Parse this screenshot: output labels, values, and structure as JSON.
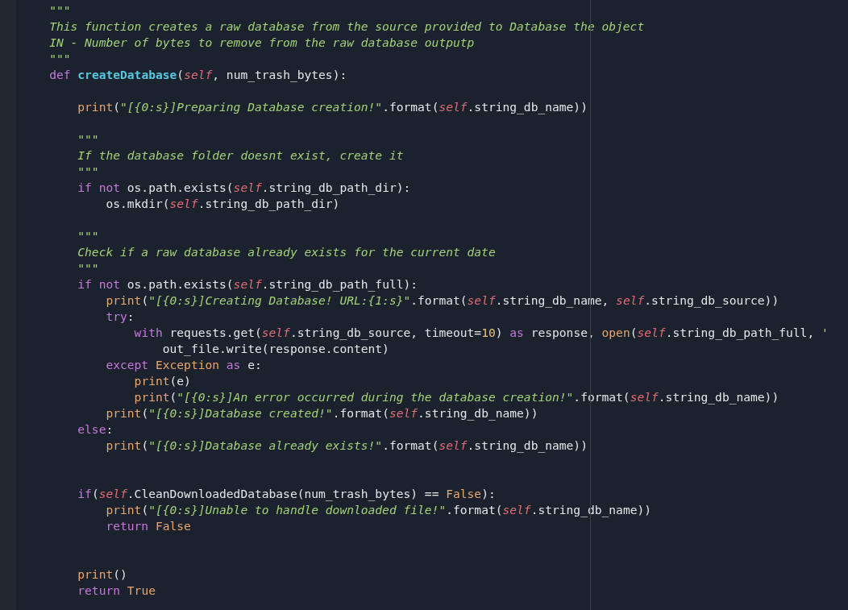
{
  "editor": {
    "sections": [
      {
        "paragraphs": [
          {
            "lines": [
              {
                "tokens": [
                  {
                    "kind": "string",
                    "text": "    \"\"\""
                  }
                ]
              },
              {
                "tokens": [
                  {
                    "kind": "string",
                    "text": "    This function creates a raw database from the source provided to Database the object"
                  }
                ]
              },
              {
                "tokens": [
                  {
                    "kind": "string",
                    "text": "    IN - Number of bytes to remove from the raw database outputp"
                  }
                ]
              },
              {
                "tokens": [
                  {
                    "kind": "string",
                    "text": "    \"\"\""
                  }
                ]
              },
              {
                "tokens": [
                  {
                    "kind": "keyword",
                    "text": "    def "
                  },
                  {
                    "kind": "function",
                    "text": "createDatabase"
                  },
                  {
                    "kind": "plain",
                    "text": "("
                  },
                  {
                    "kind": "self",
                    "text": "self"
                  },
                  {
                    "kind": "plain",
                    "text": ", num_trash_bytes):"
                  }
                ]
              }
            ]
          },
          {
            "lines": [
              {
                "tokens": [
                  {
                    "kind": "builtin",
                    "text": "        print"
                  },
                  {
                    "kind": "plain",
                    "text": "("
                  },
                  {
                    "kind": "string",
                    "text": "\"[{0:s}]Preparing Database creation!\""
                  },
                  {
                    "kind": "plain",
                    "text": ".format("
                  },
                  {
                    "kind": "self",
                    "text": "self"
                  },
                  {
                    "kind": "plain",
                    "text": ".string_db_name))"
                  }
                ]
              }
            ]
          },
          {
            "lines": [
              {
                "tokens": [
                  {
                    "kind": "string",
                    "text": "        \"\"\""
                  }
                ]
              },
              {
                "tokens": [
                  {
                    "kind": "string",
                    "text": "        If the database folder doesnt exist, create it"
                  }
                ]
              },
              {
                "tokens": [
                  {
                    "kind": "string",
                    "text": "        \"\"\""
                  }
                ]
              },
              {
                "tokens": [
                  {
                    "kind": "keyword",
                    "text": "        if "
                  },
                  {
                    "kind": "keyword",
                    "text": "not"
                  },
                  {
                    "kind": "plain",
                    "text": " os.path.exists("
                  },
                  {
                    "kind": "self",
                    "text": "self"
                  },
                  {
                    "kind": "plain",
                    "text": ".string_db_path_dir):"
                  }
                ]
              },
              {
                "tokens": [
                  {
                    "kind": "plain",
                    "text": "            os.mkdir("
                  },
                  {
                    "kind": "self",
                    "text": "self"
                  },
                  {
                    "kind": "plain",
                    "text": ".string_db_path_dir)"
                  }
                ]
              }
            ]
          },
          {
            "lines": [
              {
                "tokens": [
                  {
                    "kind": "string",
                    "text": "        \"\"\""
                  }
                ]
              },
              {
                "tokens": [
                  {
                    "kind": "string",
                    "text": "        Check if a raw database already exists for the current date"
                  }
                ]
              },
              {
                "tokens": [
                  {
                    "kind": "string",
                    "text": "        \"\"\""
                  }
                ]
              },
              {
                "tokens": [
                  {
                    "kind": "keyword",
                    "text": "        if "
                  },
                  {
                    "kind": "keyword",
                    "text": "not"
                  },
                  {
                    "kind": "plain",
                    "text": " os.path.exists("
                  },
                  {
                    "kind": "self",
                    "text": "self"
                  },
                  {
                    "kind": "plain",
                    "text": ".string_db_path_full):"
                  }
                ]
              },
              {
                "tokens": [
                  {
                    "kind": "builtin",
                    "text": "            print"
                  },
                  {
                    "kind": "plain",
                    "text": "("
                  },
                  {
                    "kind": "string",
                    "text": "\"[{0:s}]Creating Database! URL:{1:s}\""
                  },
                  {
                    "kind": "plain",
                    "text": ".format("
                  },
                  {
                    "kind": "self",
                    "text": "self"
                  },
                  {
                    "kind": "plain",
                    "text": ".string_db_name, "
                  },
                  {
                    "kind": "self",
                    "text": "self"
                  },
                  {
                    "kind": "plain",
                    "text": ".string_db_source))"
                  }
                ]
              },
              {
                "tokens": [
                  {
                    "kind": "keyword",
                    "text": "            try"
                  },
                  {
                    "kind": "plain",
                    "text": ":"
                  }
                ]
              },
              {
                "tokens": [
                  {
                    "kind": "keyword",
                    "text": "                with"
                  },
                  {
                    "kind": "plain",
                    "text": " requests.get("
                  },
                  {
                    "kind": "self",
                    "text": "self"
                  },
                  {
                    "kind": "plain",
                    "text": ".string_db_source, timeout="
                  },
                  {
                    "kind": "number",
                    "text": "10"
                  },
                  {
                    "kind": "plain",
                    "text": ") "
                  },
                  {
                    "kind": "keyword",
                    "text": "as"
                  },
                  {
                    "kind": "plain",
                    "text": " response, "
                  },
                  {
                    "kind": "builtin",
                    "text": "open"
                  },
                  {
                    "kind": "plain",
                    "text": "("
                  },
                  {
                    "kind": "self",
                    "text": "self"
                  },
                  {
                    "kind": "plain",
                    "text": ".string_db_path_full, "
                  },
                  {
                    "kind": "string",
                    "text": "'"
                  }
                ]
              },
              {
                "tokens": [
                  {
                    "kind": "plain",
                    "text": "                    out_file.write(response.content)"
                  }
                ]
              },
              {
                "tokens": [
                  {
                    "kind": "keyword",
                    "text": "            except "
                  },
                  {
                    "kind": "builtin",
                    "text": "Exception "
                  },
                  {
                    "kind": "keyword",
                    "text": "as"
                  },
                  {
                    "kind": "plain",
                    "text": " e:"
                  }
                ]
              },
              {
                "tokens": [
                  {
                    "kind": "builtin",
                    "text": "                print"
                  },
                  {
                    "kind": "plain",
                    "text": "(e)"
                  }
                ]
              },
              {
                "tokens": [
                  {
                    "kind": "builtin",
                    "text": "                print"
                  },
                  {
                    "kind": "plain",
                    "text": "("
                  },
                  {
                    "kind": "string",
                    "text": "\"[{0:s}]An error occurred during the database creation!\""
                  },
                  {
                    "kind": "plain",
                    "text": ".format("
                  },
                  {
                    "kind": "self",
                    "text": "self"
                  },
                  {
                    "kind": "plain",
                    "text": ".string_db_name))"
                  }
                ]
              },
              {
                "tokens": [
                  {
                    "kind": "builtin",
                    "text": "            print"
                  },
                  {
                    "kind": "plain",
                    "text": "("
                  },
                  {
                    "kind": "string",
                    "text": "\"[{0:s}]Database created!\""
                  },
                  {
                    "kind": "plain",
                    "text": ".format("
                  },
                  {
                    "kind": "self",
                    "text": "self"
                  },
                  {
                    "kind": "plain",
                    "text": ".string_db_name))"
                  }
                ]
              },
              {
                "tokens": [
                  {
                    "kind": "keyword",
                    "text": "        else"
                  },
                  {
                    "kind": "plain",
                    "text": ":"
                  }
                ]
              },
              {
                "tokens": [
                  {
                    "kind": "builtin",
                    "text": "            print"
                  },
                  {
                    "kind": "plain",
                    "text": "("
                  },
                  {
                    "kind": "string",
                    "text": "\"[{0:s}]Database already exists!\""
                  },
                  {
                    "kind": "plain",
                    "text": ".format("
                  },
                  {
                    "kind": "self",
                    "text": "self"
                  },
                  {
                    "kind": "plain",
                    "text": ".string_db_name))"
                  }
                ]
              }
            ]
          }
        ]
      },
      {
        "paragraphs": [
          {
            "lines": [
              {
                "tokens": [
                  {
                    "kind": "keyword",
                    "text": "        if"
                  },
                  {
                    "kind": "plain",
                    "text": "("
                  },
                  {
                    "kind": "self",
                    "text": "self"
                  },
                  {
                    "kind": "plain",
                    "text": ".CleanDownloadedDatabase(num_trash_bytes) == "
                  },
                  {
                    "kind": "builtin",
                    "text": "False"
                  },
                  {
                    "kind": "plain",
                    "text": "):"
                  }
                ]
              },
              {
                "tokens": [
                  {
                    "kind": "builtin",
                    "text": "            print"
                  },
                  {
                    "kind": "plain",
                    "text": "("
                  },
                  {
                    "kind": "string",
                    "text": "\"[{0:s}]Unable to handle downloaded file!\""
                  },
                  {
                    "kind": "plain",
                    "text": ".format("
                  },
                  {
                    "kind": "self",
                    "text": "self"
                  },
                  {
                    "kind": "plain",
                    "text": ".string_db_name))"
                  }
                ]
              },
              {
                "tokens": [
                  {
                    "kind": "keyword",
                    "text": "            return "
                  },
                  {
                    "kind": "builtin",
                    "text": "False"
                  }
                ]
              }
            ]
          }
        ]
      },
      {
        "paragraphs": [
          {
            "lines": [
              {
                "tokens": [
                  {
                    "kind": "builtin",
                    "text": "        print"
                  },
                  {
                    "kind": "plain",
                    "text": "()"
                  }
                ]
              },
              {
                "tokens": [
                  {
                    "kind": "keyword",
                    "text": "        return "
                  },
                  {
                    "kind": "builtin",
                    "text": "True"
                  }
                ]
              }
            ]
          }
        ]
      }
    ]
  }
}
